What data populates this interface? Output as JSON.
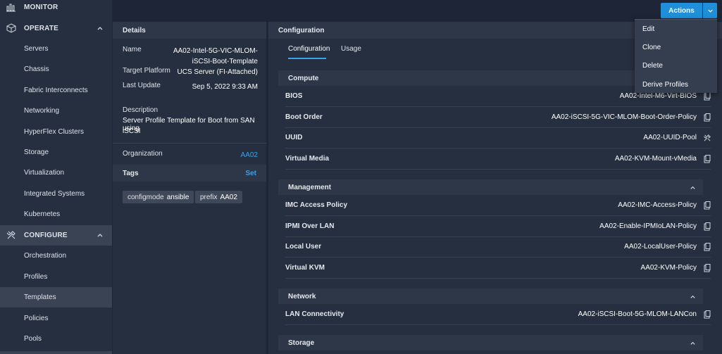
{
  "sidebar": {
    "monitor": "MONITOR",
    "operate": "OPERATE",
    "operate_items": [
      "Servers",
      "Chassis",
      "Fabric Interconnects",
      "Networking",
      "HyperFlex Clusters",
      "Storage",
      "Virtualization",
      "Integrated Systems",
      "Kubernetes"
    ],
    "configure": "CONFIGURE",
    "configure_items": [
      "Orchestration",
      "Profiles",
      "Templates",
      "Policies",
      "Pools"
    ],
    "active_item": "Templates"
  },
  "header": {
    "actions_label": "Actions"
  },
  "actions_menu": [
    "Edit",
    "Clone",
    "Delete",
    "Derive Profiles"
  ],
  "details": {
    "title": "Details",
    "name_label": "Name",
    "name_value_line1": "AA02-Intel-5G-VIC-MLOM-",
    "name_value_line2": "iSCSI-Boot-Template",
    "platform_label": "Target Platform",
    "platform_value": "UCS Server (FI-Attached)",
    "update_label": "Last Update",
    "update_value": "Sep 5, 2022 9:33 AM",
    "description_label": "Description",
    "description_line1": "Server Profile Template for Boot from SAN using",
    "description_line2": "iSCSI",
    "org_label": "Organization",
    "org_value": "AA02",
    "tags_label": "Tags",
    "tags_action": "Set",
    "tags": [
      {
        "key": "configmode",
        "value": "ansible"
      },
      {
        "key": "prefix",
        "value": "AA02"
      }
    ]
  },
  "configuration": {
    "title": "Configuration",
    "tabs": [
      "Configuration",
      "Usage"
    ],
    "sections": [
      {
        "name": "Compute",
        "rows": [
          {
            "label": "BIOS",
            "value": "AA02-Intel-M6-Virt-BIOS",
            "icon": "copy-icon"
          },
          {
            "label": "Boot Order",
            "value": "AA02-iSCSI-5G-VIC-MLOM-Boot-Order-Policy",
            "icon": "copy-icon"
          },
          {
            "label": "UUID",
            "value": "AA02-UUID-Pool",
            "icon": "tools-icon"
          },
          {
            "label": "Virtual Media",
            "value": "AA02-KVM-Mount-vMedia",
            "icon": "copy-icon"
          }
        ]
      },
      {
        "name": "Management",
        "rows": [
          {
            "label": "IMC Access Policy",
            "value": "AA02-IMC-Access-Policy",
            "icon": "copy-icon"
          },
          {
            "label": "IPMI Over LAN",
            "value": "AA02-Enable-IPMIoLAN-Policy",
            "icon": "copy-icon"
          },
          {
            "label": "Local User",
            "value": "AA02-LocalUser-Policy",
            "icon": "copy-icon"
          },
          {
            "label": "Virtual KVM",
            "value": "AA02-KVM-Policy",
            "icon": "copy-icon"
          }
        ]
      },
      {
        "name": "Network",
        "rows": [
          {
            "label": "LAN Connectivity",
            "value": "AA02-iSCSI-Boot-5G-MLOM-LANCon",
            "icon": "copy-icon"
          }
        ]
      },
      {
        "name": "Storage",
        "rows": []
      }
    ]
  },
  "colors": {
    "accent": "#1f8fd9",
    "link": "#3aa3ea",
    "background": "#1d2536",
    "panel": "#262f3f"
  }
}
